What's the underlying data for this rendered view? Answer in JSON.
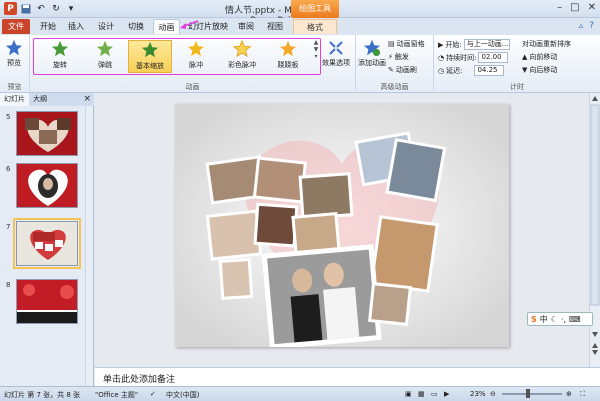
{
  "title_bar": {
    "window_title": "情人节.pptx - Microsoft PowerPoint",
    "context_tab_group": "绘图工具",
    "minimize": "–",
    "maximize": "□",
    "close": "✕"
  },
  "tabs": {
    "file": "文件",
    "items": [
      "开始",
      "插入",
      "设计",
      "切换",
      "动画",
      "幻灯片放映",
      "审阅",
      "视图",
      "格式"
    ],
    "active": "动画"
  },
  "ribbon": {
    "preview_group": {
      "button": "预览",
      "label": "预览"
    },
    "animation_group": {
      "label": "动画",
      "effects": [
        "旋转",
        "弹跳",
        "基本缩放",
        "脉冲",
        "彩色脉冲",
        "跷跷板"
      ],
      "selected": "基本缩放",
      "effect_options": "效果选项"
    },
    "advanced_group": {
      "label": "高级动画",
      "add_animation": "添加动画",
      "animation_pane": "动画窗格",
      "trigger": "触发",
      "animation_painter": "动画刷"
    },
    "timing_group": {
      "label": "计时",
      "start_label": "开始:",
      "start_value": "与上一动画...",
      "duration_label": "持续时间:",
      "duration_value": "02.00",
      "delay_label": "延迟:",
      "delay_value": "04.25",
      "reorder_title": "对动画重新排序",
      "move_earlier": "向前移动",
      "move_later": "向后移动"
    }
  },
  "left_pane": {
    "tab_slides": "幻灯片",
    "tab_outline": "大纲",
    "close": "×",
    "slides": [
      {
        "number": "5",
        "selected": false
      },
      {
        "number": "6",
        "selected": false
      },
      {
        "number": "7",
        "selected": true
      },
      {
        "number": "8",
        "selected": false
      }
    ]
  },
  "notes": {
    "placeholder": "单击此处添加备注"
  },
  "status_bar": {
    "slide_info": "幻灯片 第 7 张，共 8 张",
    "theme": "\"Office 主题\"",
    "language": "中文(中国)",
    "zoom": "23%"
  },
  "ime": {
    "label": "中"
  },
  "colors": {
    "accent_file_tab": "#c8442b",
    "gallery_highlight": "#e23be0",
    "selected_effect": "#f8cf58",
    "context_tab": "#ec7a1d"
  }
}
